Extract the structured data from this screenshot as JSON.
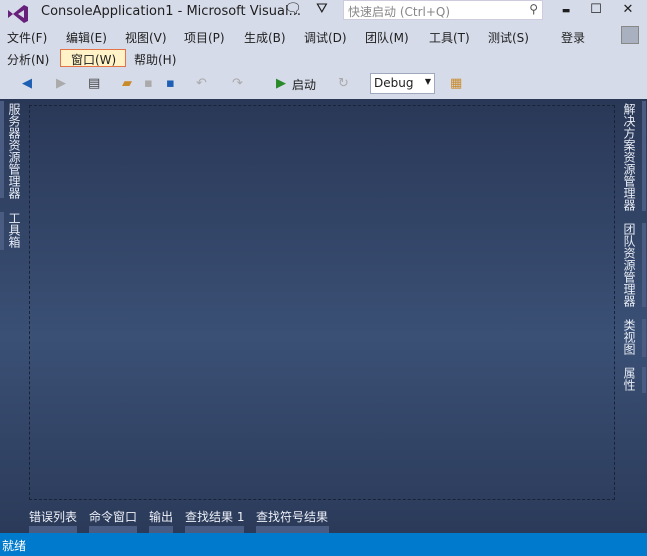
{
  "window": {
    "title": "ConsoleApplication1 - Microsoft Visual...",
    "search_placeholder": "快速启动 (Ctrl+Q)",
    "minimize": "▬",
    "maximize": "☐",
    "close": "✕",
    "feedback": "🗨",
    "filter": "⛛"
  },
  "menu": {
    "row1": [
      "文件(F)",
      "编辑(E)",
      "视图(V)",
      "项目(P)",
      "生成(B)",
      "调试(D)",
      "团队(M)",
      "工具(T)",
      "测试(S)"
    ],
    "row2": [
      "分析(N)",
      "窗口(W)",
      "帮助(H)"
    ],
    "login": "登录"
  },
  "toolbar": {
    "start": "启动",
    "config": "Debug"
  },
  "left_tabs": [
    "服务器资源管理器",
    "工具箱"
  ],
  "right_tabs": [
    "解决方案资源管理器",
    "团队资源管理器",
    "类视图",
    "属性"
  ],
  "bottom_tabs": [
    "错误列表",
    "命令窗口",
    "输出",
    "查找结果 1",
    "查找符号结果"
  ],
  "status": "就绪",
  "colors": {
    "accent": "#007acc",
    "logo": "#68217a",
    "highlight": "#fff3c7"
  }
}
